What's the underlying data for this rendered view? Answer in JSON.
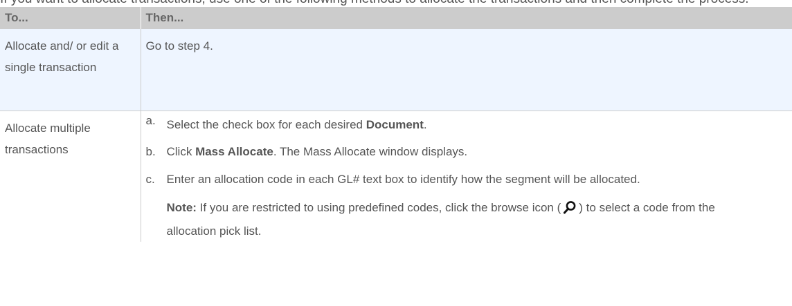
{
  "intro_text": "If you want to allocate transactions, use one of the following methods to allocate the transactions and then complete the process.",
  "table": {
    "headers": [
      "To...",
      "Then..."
    ],
    "row1": {
      "to": "Allocate and/ or edit a single transaction",
      "then": "Go to step 4."
    },
    "row2": {
      "to": "Allocate multiple transactions",
      "steps": {
        "a": {
          "marker": "a.",
          "before": "Select the check box for each desired ",
          "bold": "Document",
          "after": "."
        },
        "b": {
          "marker": "b.",
          "before": "Click ",
          "bold": "Mass Allocate",
          "after": ". The Mass Allocate window displays."
        },
        "c": {
          "marker": "c.",
          "text": "Enter an allocation code in each GL# text box to identify how the segment will be allocated."
        }
      },
      "note": {
        "label": "Note:",
        "before": " If you are restricted to using predefined codes, click the browse icon (",
        "after": ") to select a code from the allocation pick list.",
        "icon": "magnifier-icon"
      }
    }
  }
}
